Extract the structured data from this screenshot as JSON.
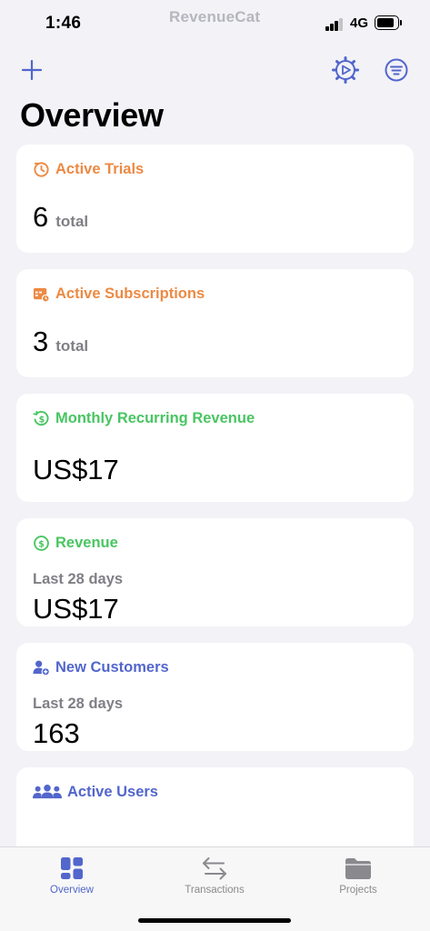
{
  "status": {
    "time": "1:46",
    "carrier_logo": "RevenueCat",
    "network": "4G",
    "battery_level": 0.7,
    "signal_bars": 4,
    "signal_bars_active": 3
  },
  "nav": {
    "add_icon": "plus-icon",
    "settings_icon": "gear-play-icon",
    "filter_icon": "filter-icon"
  },
  "page": {
    "title": "Overview"
  },
  "cards": {
    "active_trials": {
      "title": "Active Trials",
      "value": "6",
      "unit": "total",
      "icon": "timer-icon",
      "color": "#ec8a44"
    },
    "active_subscriptions": {
      "title": "Active Subscriptions",
      "value": "3",
      "unit": "total",
      "icon": "calendar-icon",
      "color": "#ec8a44"
    },
    "mrr": {
      "title": "Monthly Recurring Revenue",
      "value": "US$17",
      "icon": "recurring-dollar-icon",
      "color": "#49c562"
    },
    "revenue": {
      "title": "Revenue",
      "period": "Last 28 days",
      "value": "US$17",
      "icon": "dollar-circle-icon",
      "color": "#49c562"
    },
    "new_customers": {
      "title": "New Customers",
      "period": "Last 28 days",
      "value": "163",
      "icon": "add-person-icon",
      "color": "#5266cc"
    },
    "active_users": {
      "title": "Active Users",
      "icon": "people-icon",
      "color": "#5266cc"
    }
  },
  "tabs": [
    {
      "label": "Overview",
      "icon": "dashboard-icon",
      "active": true
    },
    {
      "label": "Transactions",
      "icon": "arrows-icon",
      "active": false
    },
    {
      "label": "Projects",
      "icon": "folder-icon",
      "active": false
    }
  ],
  "colors": {
    "accent": "#5266cc",
    "background": "#f2f2f7",
    "card": "#ffffff",
    "muted_text": "#7f7f85"
  }
}
